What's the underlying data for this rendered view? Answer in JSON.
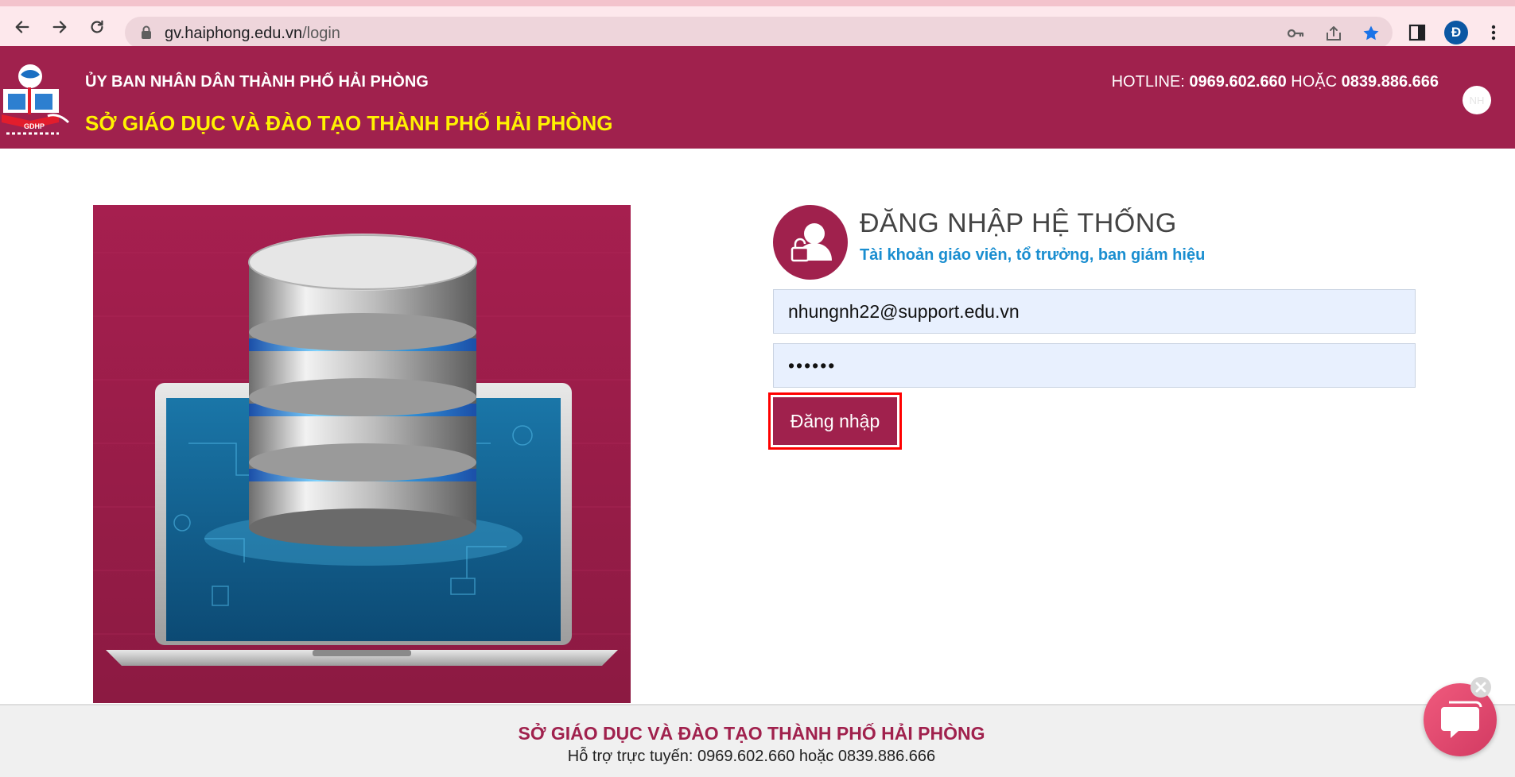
{
  "browser": {
    "url_host": "gv.haiphong.edu.vn",
    "url_path": "/login",
    "profile_initial": "Đ"
  },
  "header": {
    "line1": "ỦY BAN NHÂN DÂN THÀNH PHỐ HẢI PHÒNG",
    "line2": "SỞ GIÁO DỤC VÀ ĐÀO TẠO THÀNH PHỐ HẢI PHÒNG",
    "hotline_label": "HOTLINE: ",
    "hotline_number1": "0969.602.660",
    "hotline_or": " HOẶC ",
    "hotline_number2": "0839.886.666",
    "user_initials": "NH",
    "logo_text": "GDHP"
  },
  "login": {
    "title": "ĐĂNG NHẬP HỆ THỐNG",
    "subtitle": "Tài khoản giáo viên, tổ trưởng, ban giám hiệu",
    "email_value": "nhungnh22@support.edu.vn",
    "password_display": "••••••",
    "submit_label": "Đăng nhập"
  },
  "footer": {
    "title": "SỞ GIÁO DỤC VÀ ĐÀO TẠO THÀNH PHỐ HẢI PHÒNG",
    "support": "Hỗ trợ trực tuyến: 0969.602.660 hoặc 0839.886.666"
  },
  "colors": {
    "brand": "#a0214d",
    "header_highlight": "#fff200",
    "subtitle_blue": "#1a8ed0",
    "annotation_red": "#ff0000"
  },
  "icons": {
    "back": "arrow-left-icon",
    "forward": "arrow-right-icon",
    "reload": "reload-icon",
    "site_info": "lock-icon",
    "password_manager": "key-icon",
    "share": "share-icon",
    "bookmark": "star-icon",
    "side_panel": "side-panel-icon",
    "menu": "more-vertical-icon",
    "login_avatar": "user-lock-icon",
    "chat": "chat-bubble-icon",
    "chat_close": "close-icon"
  }
}
